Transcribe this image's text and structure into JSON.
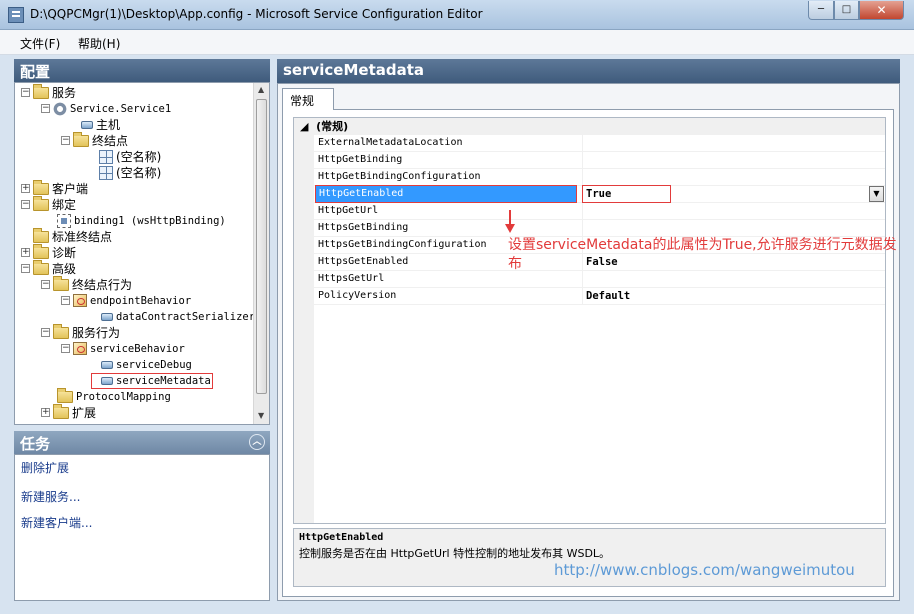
{
  "window": {
    "title": "D:\\QQPCMgr(1)\\Desktop\\App.config - Microsoft Service Configuration Editor",
    "min_glyph": "─",
    "max_glyph": "□",
    "close_glyph": "✕"
  },
  "menu": {
    "file": "文件(F)",
    "help": "帮助(H)"
  },
  "config_panel": {
    "title": "配置",
    "tree": [
      {
        "label": "服务",
        "mono": false
      },
      {
        "label": "Service.Service1",
        "mono": true
      },
      {
        "label": "主机",
        "mono": false
      },
      {
        "label": "终结点",
        "mono": false
      },
      {
        "label": "(空名称)",
        "mono": false
      },
      {
        "label": "(空名称)",
        "mono": false
      },
      {
        "label": "客户端",
        "mono": false
      },
      {
        "label": "绑定",
        "mono": false
      },
      {
        "label": "binding1 (wsHttpBinding)",
        "mono": true
      },
      {
        "label": "标准终结点",
        "mono": false
      },
      {
        "label": "诊断",
        "mono": false
      },
      {
        "label": "高级",
        "mono": false
      },
      {
        "label": "终结点行为",
        "mono": false
      },
      {
        "label": "endpointBehavior",
        "mono": true
      },
      {
        "label": "dataContractSerializer",
        "mono": true
      },
      {
        "label": "服务行为",
        "mono": false
      },
      {
        "label": "serviceBehavior",
        "mono": true
      },
      {
        "label": "serviceDebug",
        "mono": true
      },
      {
        "label": "serviceMetadata",
        "mono": true
      },
      {
        "label": "ProtocolMapping",
        "mono": true
      },
      {
        "label": "扩展",
        "mono": false
      }
    ]
  },
  "tasks_panel": {
    "title": "任务",
    "links": [
      "删除扩展",
      "新建服务...",
      "新建客户端..."
    ]
  },
  "main": {
    "title": "serviceMetadata",
    "tab": "常规",
    "category": "(常规)",
    "properties": [
      {
        "name": "ExternalMetadataLocation",
        "value": ""
      },
      {
        "name": "HttpGetBinding",
        "value": ""
      },
      {
        "name": "HttpGetBindingConfiguration",
        "value": ""
      },
      {
        "name": "HttpGetEnabled",
        "value": "True"
      },
      {
        "name": "HttpGetUrl",
        "value": ""
      },
      {
        "name": "HttpsGetBinding",
        "value": ""
      },
      {
        "name": "HttpsGetBindingConfiguration",
        "value": ""
      },
      {
        "name": "HttpsGetEnabled",
        "value": "False"
      },
      {
        "name": "HttpsGetUrl",
        "value": ""
      },
      {
        "name": "PolicyVersion",
        "value": "Default"
      }
    ],
    "selected_index": 3,
    "description": {
      "title": "HttpGetEnabled",
      "text": "控制服务是否在由 HttpGetUrl 特性控制的地址发布其 WSDL。"
    }
  },
  "annotation": {
    "text": "设置serviceMetadata的此属性为True,允许服务进行元数据发布",
    "color": "#e23b3b"
  },
  "watermark": "http://www.cnblogs.com/wangweimutou"
}
